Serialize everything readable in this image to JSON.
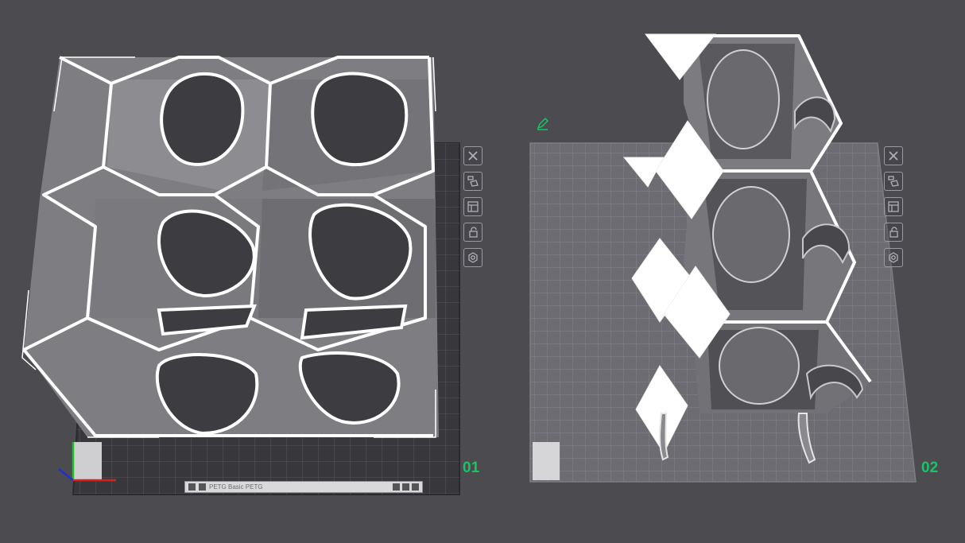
{
  "viewport": {
    "background": "#4b4b50"
  },
  "plates": [
    {
      "number": "01",
      "tools": [
        "close-icon",
        "arrange-icon",
        "layout-icon",
        "lock-icon",
        "settings-icon"
      ]
    },
    {
      "number": "02",
      "tools": [
        "close-icon",
        "arrange-icon",
        "layout-icon",
        "lock-icon",
        "settings-icon"
      ]
    }
  ],
  "plate_strip": {
    "label": "PETG Basic PETG"
  },
  "colors": {
    "plate_number": "#19c464",
    "plate_dark": "#3a3a3e",
    "plate_light": "#6e6e74",
    "model": "#8a8a8e",
    "highlight": "#ffffff"
  }
}
